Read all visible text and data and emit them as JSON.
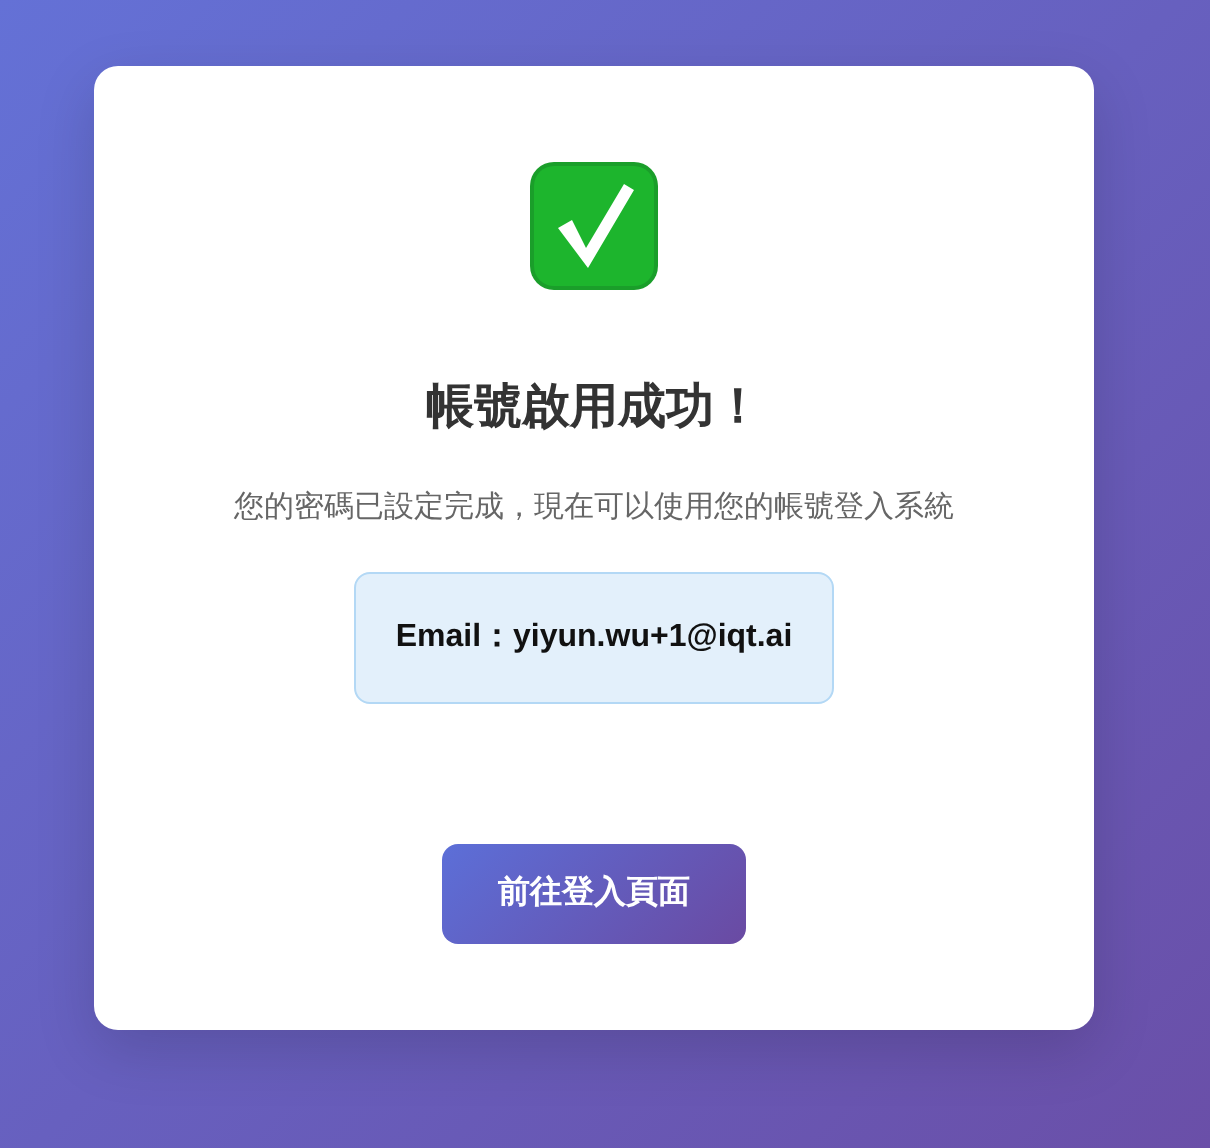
{
  "card": {
    "title": "帳號啟用成功！",
    "message": "您的密碼已設定完成，現在可以使用您的帳號登入系統",
    "email": "Email：yiyun.wu+1@iqt.ai",
    "button": "前往登入頁面"
  }
}
